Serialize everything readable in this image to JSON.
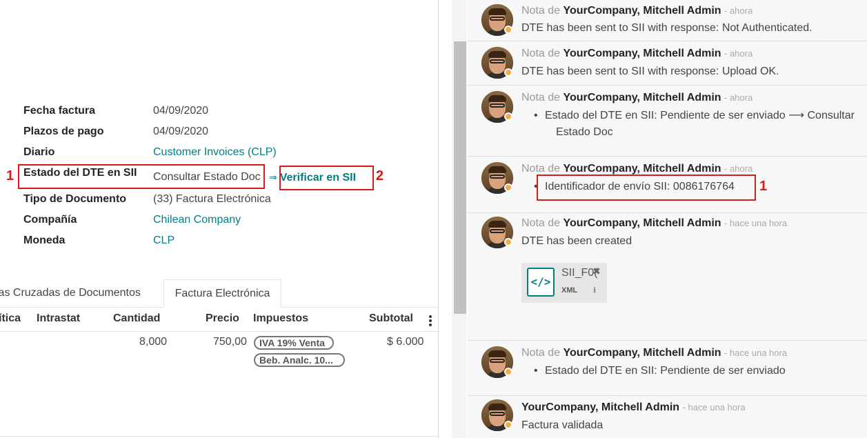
{
  "form": {
    "fields": [
      {
        "label": "Fecha factura",
        "value": "04/09/2020"
      },
      {
        "label": "Plazos de pago",
        "value": "04/09/2020"
      },
      {
        "label": "Diario",
        "value": "Customer Invoices (CLP)"
      },
      {
        "label": "Estado del DTE en SII",
        "value": "Consultar Estado Doc"
      },
      {
        "label": "Tipo de Documento",
        "value": "(33) Factura Electrónica"
      },
      {
        "label": "Compañía",
        "value": "Chilean Company"
      },
      {
        "label": "Moneda",
        "value": "CLP"
      }
    ],
    "verify_arrow": "⇒",
    "verify_label": "Verificar en SII",
    "annotations": {
      "one": "1",
      "two": "2"
    }
  },
  "tabs": [
    {
      "label": "cias Cruzadas de Documentos"
    },
    {
      "label": "Factura Electrónica"
    }
  ],
  "table": {
    "headers": [
      "ítica",
      "Intrastat",
      "Cantidad",
      "Precio",
      "Impuestos",
      "Subtotal"
    ],
    "row": {
      "cantidad": "8,000",
      "precio": "750,00",
      "taxes": [
        "IVA 19% Venta",
        "Beb. Analc. 10..."
      ],
      "subtotal": "$ 6.000"
    }
  },
  "chatter": {
    "nota": "Nota de",
    "author": "YourCompany, Mitchell Admin",
    "messages": [
      {
        "when": "- ahora",
        "text": "DTE has been sent to SII with response: Not Authenticated."
      },
      {
        "when": "- ahora",
        "text": "DTE has been sent to SII with response: Upload OK."
      },
      {
        "when": "- ahora",
        "text": "Estado del DTE en SII: Pendiente de ser enviado ⟶ Consultar",
        "text2": "Estado Doc"
      },
      {
        "when": "- ahora",
        "text": "Identificador de envío SII: 0086176764"
      },
      {
        "when": "- hace una hora",
        "text": "DTE has been created"
      },
      {
        "when": "- hace una hora",
        "text": "Estado del DTE en SII: Pendiente de ser enviado"
      },
      {
        "when": "- hace una hora",
        "text": "Factura validada"
      }
    ],
    "attachment": {
      "name": "SII_F0(",
      "ext": "XML",
      "icon": "code-icon"
    },
    "annotation": "1"
  },
  "colors": {
    "accent": "#017e84",
    "annotation": "#d9191c",
    "status": "#f0ad4e"
  }
}
